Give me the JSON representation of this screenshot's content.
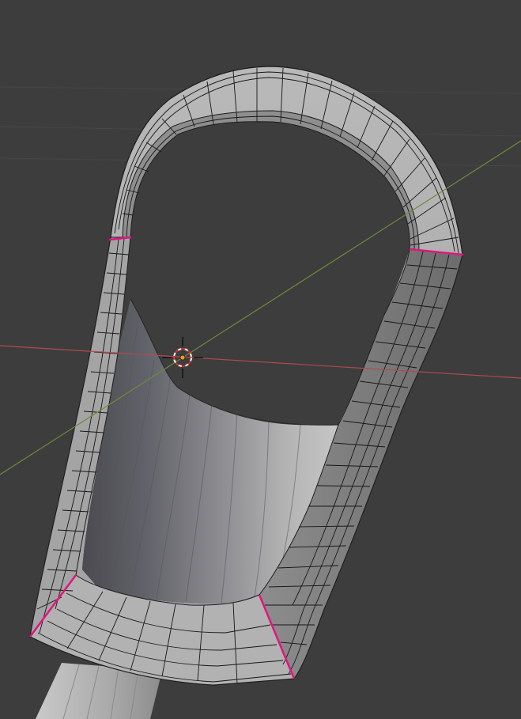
{
  "viewport": {
    "background_color": "#3d3d3d",
    "grid_line_color": "#4a4a4a",
    "x_axis_color": "#b14a4f",
    "y_axis_color": "#6e8a3c",
    "seam_color": "#e0157f",
    "wire_color": "#161616",
    "mesh_light_color": "#bdbdbd",
    "mesh_mid_color": "#9a9a9a",
    "mesh_dark_color": "#6e6e6e",
    "inner_surface_dark_color": "#4d4d52",
    "inner_surface_light_color": "#c4c4c4",
    "origin_dot_color": "#ff9a18"
  },
  "viewport_elements": {
    "object": "mesh-object",
    "cursor": "3d-cursor-icon",
    "origin": "object-origin"
  }
}
